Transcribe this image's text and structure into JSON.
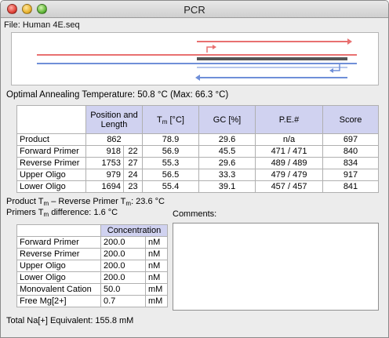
{
  "window": {
    "title": "PCR"
  },
  "file_label": "File: Human 4E.seq",
  "colors": {
    "forward": "#e87070",
    "reverse": "#6f8fd8",
    "product": "#555555",
    "header_bg": "#d0d2f0"
  },
  "annealing": "Optimal Annealing Temperature: 50.8 °C (Max: 66.3 °C)",
  "results": {
    "headers": {
      "position_length": "Position and Length",
      "tm_prefix": "T",
      "tm_sub": "m",
      "tm_suffix": " [°C]",
      "gc": "GC [%]",
      "pe": "P.E.#",
      "score": "Score"
    },
    "rows": [
      {
        "name": "Product",
        "position": "862",
        "length": "",
        "tm": "78.9",
        "gc": "29.6",
        "pe": "n/a",
        "score": "697"
      },
      {
        "name": "Forward Primer",
        "position": "918",
        "length": "22",
        "tm": "56.9",
        "gc": "45.5",
        "pe": "471 / 471",
        "score": "840"
      },
      {
        "name": "Reverse Primer",
        "position": "1753",
        "length": "27",
        "tm": "55.3",
        "gc": "29.6",
        "pe": "489 / 489",
        "score": "834"
      },
      {
        "name": "Upper Oligo",
        "position": "979",
        "length": "24",
        "tm": "56.5",
        "gc": "33.3",
        "pe": "479 / 479",
        "score": "917"
      },
      {
        "name": "Lower Oligo",
        "position": "1694",
        "length": "23",
        "tm": "55.4",
        "gc": "39.1",
        "pe": "457 / 457",
        "score": "841"
      }
    ]
  },
  "differences": {
    "product_a": "Product T",
    "product_sub1": "m",
    "product_b": " – Reverse Primer T",
    "product_sub2": "m",
    "product_c": ": 23.6 °C",
    "primers_a": "Primers T",
    "primers_sub": "m",
    "primers_b": " difference: 1.6 °C"
  },
  "comments_label": "Comments:",
  "concentration": {
    "header": "Concentration",
    "rows": [
      {
        "name": "Forward Primer",
        "value": "200.0",
        "unit": "nM"
      },
      {
        "name": "Reverse Primer",
        "value": "200.0",
        "unit": "nM"
      },
      {
        "name": "Upper Oligo",
        "value": "200.0",
        "unit": "nM"
      },
      {
        "name": "Lower Oligo",
        "value": "200.0",
        "unit": "nM"
      },
      {
        "name": "Monovalent Cation",
        "value": "50.0",
        "unit": "mM"
      },
      {
        "name": "Free Mg[2+]",
        "value": "0.7",
        "unit": "mM"
      }
    ]
  },
  "total": "Total Na[+] Equivalent: 155.8 mM"
}
